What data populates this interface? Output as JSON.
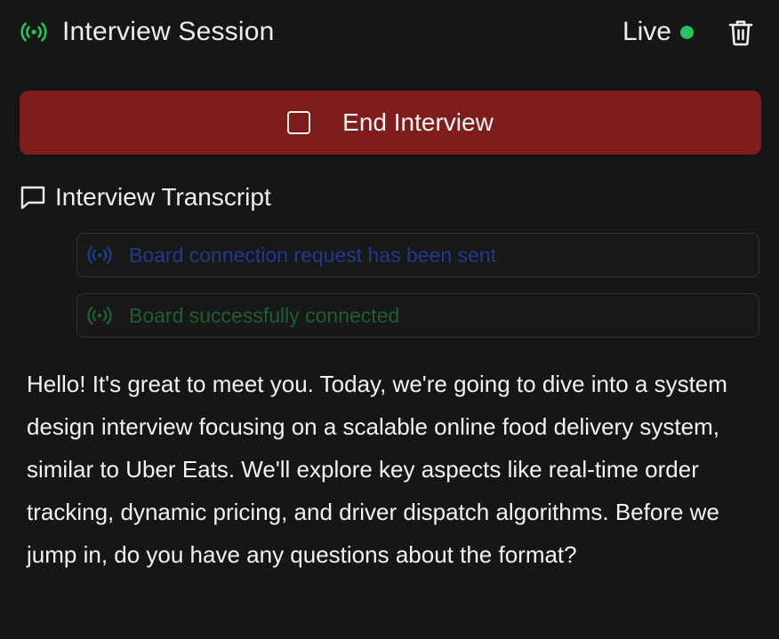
{
  "header": {
    "title": "Interview Session",
    "status": "Live",
    "status_color": "#22c55e",
    "icons": {
      "signal": "signal-broadcast-icon",
      "delete": "trash-icon"
    }
  },
  "actions": {
    "end_label": "End Interview",
    "end_color": "#7f1d1d",
    "end_icon": "stop-square-icon"
  },
  "transcript": {
    "heading": "Interview Transcript",
    "heading_icon": "chat-bubble-icon",
    "events": [
      {
        "text": "Board connection request has been sent",
        "color": "#1e3a8a"
      },
      {
        "text": "Board successfully connected",
        "color": "#1f5e31"
      }
    ],
    "messages": [
      {
        "text": "Hello! It's great to meet you. Today, we're going to dive into a system design interview focusing on a scalable online food delivery system, similar to Uber Eats. We'll explore key aspects like real-time order tracking, dynamic pricing, and driver dispatch algorithms. Before we jump in, do you have any questions about the format?"
      }
    ]
  }
}
